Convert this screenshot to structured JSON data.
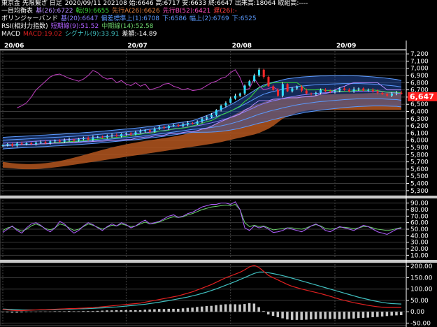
{
  "header": {
    "line1": {
      "symbol": "東京金 先限繋ぎ 日足",
      "stats": "2020/09/11 202108 始:6646 高:6717 安:6633 終:6647 出来高:18064 取組高:----"
    },
    "line2": {
      "name": "一目均衡表",
      "base": "基(26):6722",
      "conv": "転(9):6655",
      "spanA": "先行A(26):6626",
      "spanB": "先行B(52):6421",
      "lag": "遅(26):-"
    },
    "line3": {
      "name": "ボリンジャーバンド",
      "ma": "基(20):6647",
      "dev": "偏差標準上(1):6708",
      "low": "下:6586",
      "up2": "幅上(2):6769",
      "low2": "下:6525"
    },
    "line4": {
      "name": "RSI(相対力指数)",
      "short": "短期線(9):51.52",
      "mid": "中期線(14):52.58"
    },
    "line5": {
      "name": "MACD",
      "macd": "MACD:19.02",
      "signal": "シグナル(9):33.91",
      "diff": "差額:-14.89"
    }
  },
  "colors": {
    "base": "#b98cff",
    "conv": "#38d838",
    "spanA": "#d0702a",
    "spanB": "#ff50c0",
    "lag": "#ff4040",
    "boll": "#5c9bff",
    "rsiShort": "#b060ff",
    "rsiMid": "#6ad06a",
    "macd": "#e02020",
    "signal": "#40c0c0",
    "price": "#ff3030",
    "cloud": "#b4561e"
  },
  "date_labels": [
    "20/06",
    "20/07",
    "20/08",
    "20/09"
  ],
  "price_marker": "6,647",
  "chart_data": [
    {
      "type": "candlestick",
      "title": "東京金 先限繋ぎ 日足",
      "y_ticks": [
        "7,200",
        "7,100",
        "7,000",
        "6,900",
        "6,800",
        "6,700",
        "6,600",
        "6,500",
        "6,400",
        "6,300",
        "6,200",
        "6,100",
        "6,000",
        "5,900",
        "5,800",
        "5,700",
        "5,600",
        "5,500",
        "5,400",
        "5,300"
      ],
      "ylim": [
        5250,
        7240
      ],
      "close": [
        5930,
        5945,
        5925,
        5955,
        5945,
        5960,
        5950,
        5965,
        5975,
        5960,
        5985,
        5995,
        5980,
        6000,
        6010,
        5995,
        6015,
        6030,
        6010,
        6040,
        6050,
        6040,
        6060,
        6070,
        6055,
        6085,
        6095,
        6080,
        6110,
        6125,
        6140,
        6120,
        6160,
        6180,
        6170,
        6200,
        6210,
        6200,
        6220,
        6240,
        6230,
        6260,
        6300,
        6320,
        6350,
        6420,
        6480,
        6520,
        6580,
        6620,
        6650,
        6760,
        6820,
        6900,
        6980,
        6880,
        6750,
        6700,
        6620,
        6780,
        6680,
        6720,
        6740,
        6690,
        6650,
        6640,
        6660,
        6700,
        6680,
        6670,
        6690,
        6720,
        6700,
        6680,
        6710,
        6720,
        6690,
        6700,
        6680,
        6660,
        6640,
        6620,
        6650,
        6660,
        6647
      ],
      "bb_mid": [
        5960,
        5965,
        5968,
        5972,
        5975,
        5978,
        5982,
        5986,
        5990,
        5993,
        5997,
        6001,
        6004,
        6008,
        6012,
        6016,
        6020,
        6025,
        6030,
        6035,
        6040,
        6046,
        6052,
        6058,
        6064,
        6070,
        6076,
        6082,
        6088,
        6095,
        6103,
        6111,
        6119,
        6127,
        6136,
        6145,
        6154,
        6163,
        6172,
        6182,
        6192,
        6202,
        6215,
        6228,
        6242,
        6258,
        6276,
        6296,
        6318,
        6342,
        6368,
        6396,
        6425,
        6455,
        6486,
        6510,
        6530,
        6548,
        6562,
        6580,
        6594,
        6606,
        6618,
        6628,
        6636,
        6643,
        6650,
        6656,
        6660,
        6664,
        6668,
        6672,
        6676,
        6678,
        6680,
        6682,
        6681,
        6680,
        6679,
        6676,
        6673,
        6668,
        6663,
        6658,
        6647
      ],
      "ichimoku_spanA": [
        5700,
        5690,
        5682,
        5676,
        5672,
        5670,
        5670,
        5672,
        5676,
        5682,
        5690,
        5700,
        5712,
        5726,
        5742,
        5758,
        5776,
        5794,
        5812,
        5830,
        5848,
        5866,
        5884,
        5900,
        5916,
        5930,
        5944,
        5956,
        5968,
        5980,
        5990,
        6000,
        6010,
        6020,
        6030,
        6040,
        6052,
        6064,
        6078,
        6094,
        6112,
        6132,
        6154,
        6178,
        6204,
        6232,
        6262,
        6294,
        6328,
        6362,
        6396,
        6428,
        6458,
        6486,
        6510,
        6530,
        6548,
        6562,
        6574,
        6584,
        6592,
        6600,
        6606,
        6612,
        6618,
        6622,
        6626,
        6630,
        6634,
        6638,
        6640,
        6642,
        6644,
        6646,
        6648,
        6650,
        6652,
        6654,
        6656,
        6658,
        6660,
        6662,
        6664,
        6666,
        6668
      ],
      "ichimoku_spanB": [
        5620,
        5615,
        5610,
        5605,
        5600,
        5598,
        5598,
        5600,
        5604,
        5610,
        5616,
        5624,
        5632,
        5640,
        5650,
        5660,
        5670,
        5680,
        5690,
        5700,
        5710,
        5720,
        5730,
        5740,
        5750,
        5760,
        5770,
        5780,
        5790,
        5800,
        5810,
        5820,
        5830,
        5840,
        5850,
        5860,
        5870,
        5880,
        5890,
        5900,
        5910,
        5920,
        5930,
        5940,
        5950,
        5962,
        5975,
        5990,
        6005,
        6020,
        6035,
        6050,
        6065,
        6080,
        6100,
        6130,
        6160,
        6200,
        6250,
        6300,
        6330,
        6355,
        6380,
        6400,
        6410,
        6418,
        6421,
        6421,
        6421,
        6421,
        6421,
        6421,
        6421,
        6421,
        6421,
        6421,
        6421,
        6421,
        6421,
        6421,
        6421,
        6421,
        6421,
        6421,
        6421
      ],
      "lagging_line": [
        6450,
        6480,
        6520,
        6600,
        6700,
        6760,
        6820,
        6880,
        6910,
        6920,
        6890,
        6860,
        6840,
        6820,
        6850,
        6900,
        6970,
        6940,
        6880,
        6850,
        6860,
        6800,
        6830,
        6780,
        6760,
        6800,
        6750,
        6780,
        6700,
        6720,
        6740,
        6780,
        6790,
        6750,
        6730,
        6700,
        6720,
        6690,
        6700,
        6720,
        6760,
        6800,
        6820,
        6860,
        6880,
        6940,
        6980,
        6870,
        6700,
        6720,
        6860,
        6760,
        6700,
        6720,
        6740,
        6700
      ]
    },
    {
      "type": "line",
      "title": "RSI(相対力指数)",
      "y_ticks": [
        "90.00",
        "80.00",
        "70.00",
        "60.00",
        "50.00",
        "40.00",
        "30.00",
        "20.00",
        "10.00"
      ],
      "ylim": [
        5,
        95
      ],
      "series": [
        {
          "name": "短期線(9)",
          "values": [
            45,
            50,
            55,
            48,
            44,
            52,
            58,
            60,
            56,
            50,
            46,
            52,
            62,
            58,
            50,
            44,
            48,
            55,
            60,
            57,
            52,
            48,
            54,
            58,
            55,
            60,
            57,
            52,
            55,
            60,
            64,
            58,
            60,
            62,
            66,
            70,
            72,
            68,
            70,
            74,
            76,
            80,
            84,
            86,
            88,
            88,
            90,
            90,
            88,
            92,
            80,
            52,
            48,
            55,
            52,
            54,
            50,
            45,
            46,
            48,
            52,
            50,
            48,
            46,
            50,
            55,
            58,
            54,
            48,
            46,
            50,
            54,
            52,
            50,
            48,
            52,
            56,
            54,
            50,
            46,
            44,
            42,
            46,
            50,
            51.52
          ]
        },
        {
          "name": "中期線(14)",
          "values": [
            48,
            52,
            54,
            50,
            47,
            50,
            55,
            58,
            55,
            51,
            49,
            52,
            58,
            56,
            52,
            48,
            50,
            54,
            58,
            56,
            53,
            50,
            53,
            56,
            55,
            58,
            56,
            54,
            55,
            58,
            61,
            58,
            59,
            61,
            64,
            67,
            69,
            68,
            69,
            72,
            74,
            77,
            80,
            82,
            84,
            85,
            86,
            87,
            86,
            88,
            80,
            60,
            54,
            56,
            54,
            55,
            52,
            49,
            50,
            51,
            52,
            52,
            51,
            50,
            52,
            55,
            57,
            55,
            51,
            50,
            51,
            53,
            53,
            52,
            51,
            52,
            54,
            54,
            52,
            50,
            49,
            48,
            49,
            51,
            52.58
          ]
        }
      ]
    },
    {
      "type": "bar",
      "title": "MACD",
      "y_ticks": [
        "200.00",
        "150.00",
        "100.00",
        "50.00",
        "0.00",
        "-50.00"
      ],
      "ylim": [
        -55,
        210
      ],
      "series": [
        {
          "name": "MACD",
          "values": [
            10,
            8,
            6,
            5,
            5,
            6,
            7,
            8,
            9,
            9,
            10,
            11,
            12,
            13,
            14,
            14,
            15,
            16,
            17,
            18,
            20,
            22,
            24,
            26,
            28,
            30,
            32,
            34,
            36,
            38,
            42,
            46,
            50,
            54,
            58,
            62,
            66,
            70,
            76,
            82,
            88,
            96,
            104,
            112,
            120,
            130,
            140,
            150,
            158,
            166,
            174,
            185,
            198,
            205,
            195,
            178,
            160,
            150,
            140,
            130,
            120,
            112,
            106,
            100,
            95,
            90,
            85,
            80,
            74,
            68,
            62,
            55,
            50,
            45,
            40,
            36,
            32,
            28,
            25,
            22,
            20,
            19,
            19,
            19,
            19.02
          ]
        },
        {
          "name": "シグナル(9)",
          "values": [
            12,
            11,
            10,
            9,
            8,
            8,
            8,
            8,
            8,
            8,
            9,
            9,
            10,
            11,
            11,
            12,
            13,
            13,
            14,
            15,
            16,
            17,
            18,
            20,
            21,
            23,
            25,
            27,
            29,
            31,
            33,
            36,
            39,
            42,
            46,
            49,
            53,
            57,
            61,
            65,
            70,
            75,
            81,
            87,
            94,
            101,
            109,
            117,
            125,
            133,
            142,
            151,
            160,
            169,
            175,
            175,
            172,
            168,
            164,
            159,
            154,
            148,
            142,
            136,
            130,
            124,
            118,
            112,
            106,
            100,
            94,
            88,
            82,
            76,
            70,
            64,
            59,
            54,
            49,
            45,
            41,
            38,
            36,
            35,
            33.91
          ]
        }
      ]
    }
  ]
}
